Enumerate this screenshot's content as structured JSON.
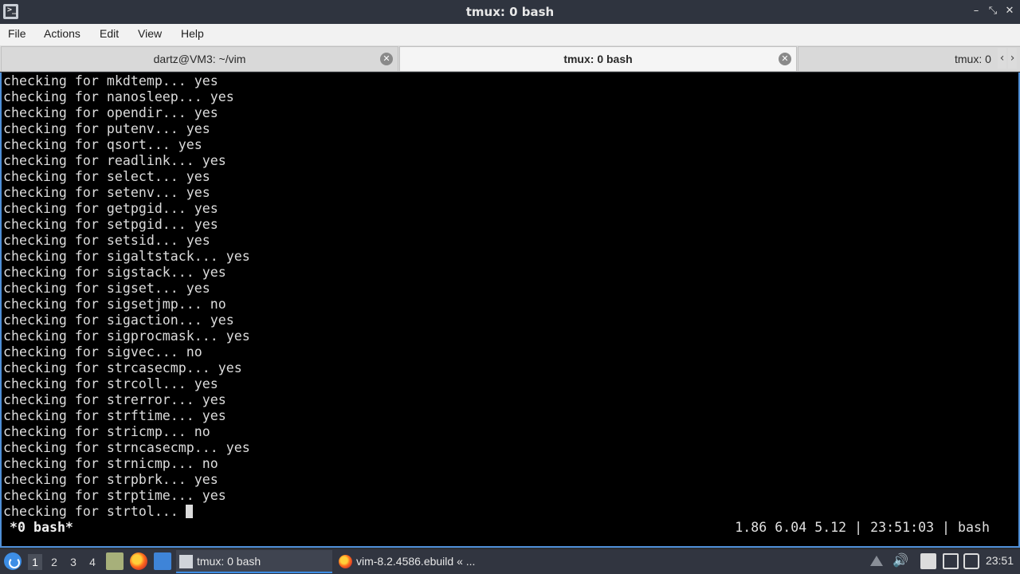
{
  "window": {
    "title": "tmux: 0 bash",
    "app_icon_glyph": ">_",
    "controls": {
      "minimize": "–",
      "maximize": "⤡",
      "close": "✕"
    }
  },
  "menu": [
    "File",
    "Actions",
    "Edit",
    "View",
    "Help"
  ],
  "tabs": [
    {
      "label": "dartz@VM3: ~/vim",
      "active": false
    },
    {
      "label": "tmux: 0 bash",
      "active": true
    },
    {
      "label": "tmux: 0",
      "active": false
    }
  ],
  "tab_nav": {
    "prev": "‹",
    "next": "›"
  },
  "terminal": {
    "lines": [
      "checking for mkdtemp... yes",
      "checking for nanosleep... yes",
      "checking for opendir... yes",
      "checking for putenv... yes",
      "checking for qsort... yes",
      "checking for readlink... yes",
      "checking for select... yes",
      "checking for setenv... yes",
      "checking for getpgid... yes",
      "checking for setpgid... yes",
      "checking for setsid... yes",
      "checking for sigaltstack... yes",
      "checking for sigstack... yes",
      "checking for sigset... yes",
      "checking for sigsetjmp... no",
      "checking for sigaction... yes",
      "checking for sigprocmask... yes",
      "checking for sigvec... no",
      "checking for strcasecmp... yes",
      "checking for strcoll... yes",
      "checking for strerror... yes",
      "checking for strftime... yes",
      "checking for stricmp... no",
      "checking for strncasecmp... yes",
      "checking for strnicmp... no",
      "checking for strpbrk... yes",
      "checking for strptime... yes",
      "checking for strtol... "
    ],
    "status_left": "*0 bash*",
    "status_right": "1.86 6.04 5.12 | 23:51:03 | bash"
  },
  "taskbar": {
    "workspaces": [
      "1",
      "2",
      "3",
      "4"
    ],
    "active_workspace": "1",
    "tasks": [
      {
        "label": "tmux: 0 bash",
        "icon": "terminal-icon",
        "active": true
      },
      {
        "label": "vim-8.2.4586.ebuild « ...",
        "icon": "firefox-icon",
        "active": false
      }
    ],
    "clock": "23:51"
  },
  "colors": {
    "accent": "#4f8fd8",
    "terminal_bg": "#000000",
    "terminal_fg": "#dcdcdc"
  }
}
